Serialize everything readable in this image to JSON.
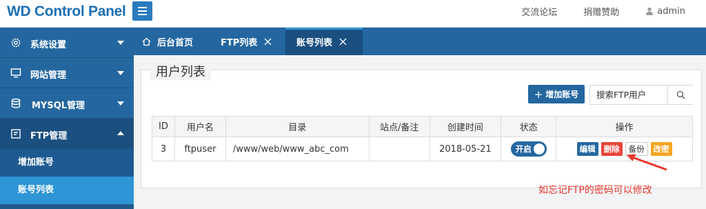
{
  "header": {
    "brand": "WD Control Panel",
    "links": [
      "交流论坛",
      "捐赠赞助"
    ],
    "user": "admin"
  },
  "sidebar": {
    "items": [
      {
        "label": "系统设置",
        "icon": "gear-icon"
      },
      {
        "label": "网站管理",
        "icon": "monitor-icon"
      },
      {
        "label": "MYSQL管理",
        "icon": "database-icon"
      },
      {
        "label": "FTP管理",
        "icon": "ftp-icon"
      }
    ],
    "subitems": [
      "增加账号",
      "账号列表"
    ]
  },
  "tabs": [
    {
      "label": "后台首页"
    },
    {
      "label": "FTP列表"
    },
    {
      "label": "账号列表"
    }
  ],
  "main": {
    "title": "用户列表",
    "add_button": "增加账号",
    "search_placeholder": "搜索FTP用户",
    "columns": [
      "ID",
      "用户名",
      "目录",
      "站点/备注",
      "创建时间",
      "状态",
      "操作"
    ],
    "rows": [
      {
        "id": "3",
        "username": "ftpuser",
        "directory": "/www/web/www_abc_com",
        "site_note": "",
        "created": "2018-05-21",
        "status": "开启"
      }
    ],
    "actions": [
      "编辑",
      "删除",
      "备份",
      "改密"
    ]
  },
  "annotation": {
    "text": "如忘记FTP的密码可以修改"
  },
  "colors": {
    "primary": "#2467a0",
    "danger": "#e9453b",
    "warning": "#f5a623",
    "annotation": "#e8382c"
  }
}
